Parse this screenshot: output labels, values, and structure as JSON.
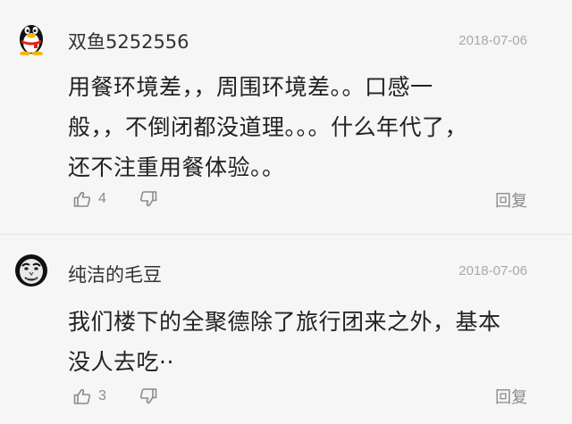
{
  "comments": [
    {
      "username": "双鱼5252556",
      "date": "2018-07-06",
      "lines": [
        "用餐环境差，，周围环境差。。口感一",
        "般，，不倒闭都没道理。。。什么年代了，",
        "还不注重用餐体验。。"
      ],
      "likes": "4",
      "reply_label": "回复",
      "avatar_icon": "penguin-avatar-icon"
    },
    {
      "username": "纯洁的毛豆",
      "date": "2018-07-06",
      "lines": [
        "我们楼下的全聚德除了旅行团来之外，基本",
        "没人去吃··"
      ],
      "likes": "3",
      "reply_label": "回复",
      "avatar_icon": "meme-face-avatar-icon"
    }
  ],
  "colors": {
    "background": "#f6f6f6",
    "text": "#222222",
    "muted": "#8a8a8a",
    "timestamp": "#a9a9a9",
    "divider": "#e4e4e4"
  }
}
